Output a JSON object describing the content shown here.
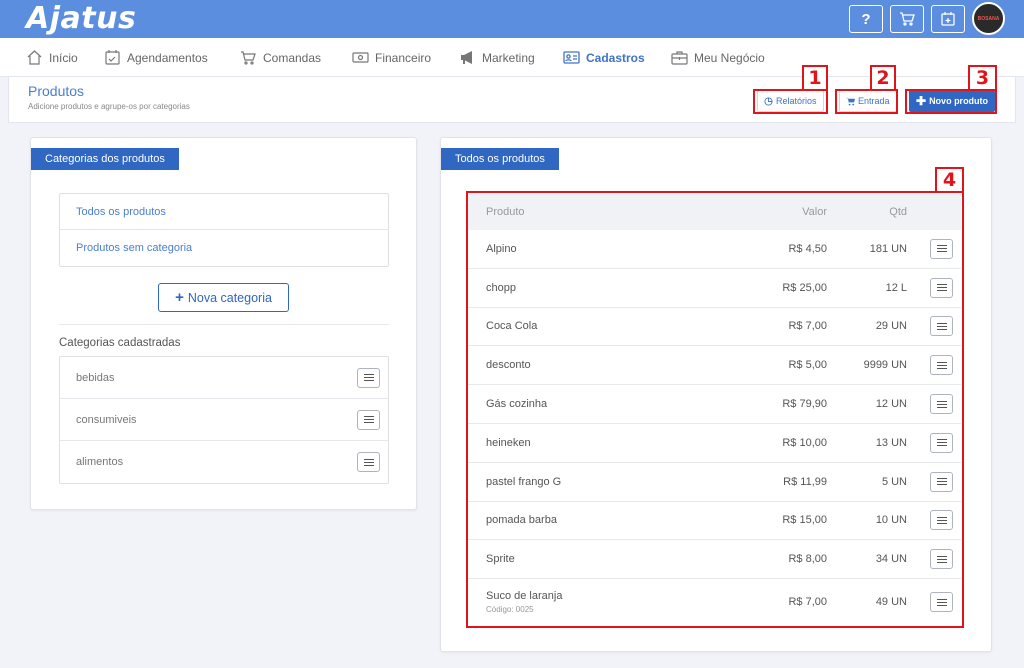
{
  "app": {
    "logo": "Ajatus"
  },
  "topbar": {
    "help_label": "?",
    "avatar_text": "BOSANA"
  },
  "nav": [
    {
      "label": "Início",
      "icon": "home-icon",
      "active": false
    },
    {
      "label": "Agendamentos",
      "icon": "calendar-check-icon",
      "active": false
    },
    {
      "label": "Comandas",
      "icon": "cart-icon",
      "active": false
    },
    {
      "label": "Financeiro",
      "icon": "money-icon",
      "active": false
    },
    {
      "label": "Marketing",
      "icon": "megaphone-icon",
      "active": false
    },
    {
      "label": "Cadastros",
      "icon": "id-card-icon",
      "active": true
    },
    {
      "label": "Meu Negócio",
      "icon": "briefcase-icon",
      "active": false
    }
  ],
  "header": {
    "title": "Produtos",
    "subtitle": "Adicione produtos e agrupe-os por categorias",
    "relatorios_label": "Relatórios",
    "entrada_label": "Entrada",
    "novo_produto_label": "Novo produto"
  },
  "annotations": [
    "1",
    "2",
    "3",
    "4"
  ],
  "categories_panel": {
    "title": "Categorias dos produtos",
    "links": [
      "Todos os produtos",
      "Produtos sem categoria"
    ],
    "new_category_label": "Nova categoria",
    "registered_title": "Categorias cadastradas",
    "registered": [
      "bebidas",
      "consumiveis",
      "alimentos"
    ]
  },
  "products_panel": {
    "title": "Todos os produtos",
    "columns": {
      "product": "Produto",
      "value": "Valor",
      "qty": "Qtd"
    },
    "rows": [
      {
        "name": "Alpino",
        "value": "R$ 4,50",
        "qty": "181 UN"
      },
      {
        "name": "chopp",
        "value": "R$ 25,00",
        "qty": "12 L"
      },
      {
        "name": "Coca Cola",
        "value": "R$ 7,00",
        "qty": "29 UN"
      },
      {
        "name": "desconto",
        "value": "R$ 5,00",
        "qty": "9999 UN"
      },
      {
        "name": "Gás cozinha",
        "value": "R$ 79,90",
        "qty": "12 UN"
      },
      {
        "name": "heineken",
        "value": "R$ 10,00",
        "qty": "13 UN"
      },
      {
        "name": "pastel frango G",
        "value": "R$ 11,99",
        "qty": "5 UN"
      },
      {
        "name": "pomada barba",
        "value": "R$ 15,00",
        "qty": "10 UN"
      },
      {
        "name": "Sprite",
        "value": "R$ 8,00",
        "qty": "34 UN"
      },
      {
        "name": "Suco de laranja",
        "value": "R$ 7,00",
        "qty": "49 UN",
        "code": "Código: 0025"
      }
    ]
  },
  "colors": {
    "topbar": "#5b8ede",
    "primary": "#2f67c2",
    "annotation": "#e1141b"
  }
}
